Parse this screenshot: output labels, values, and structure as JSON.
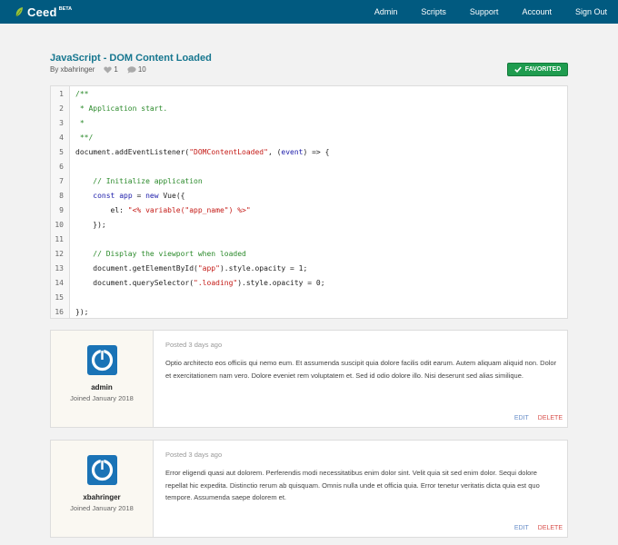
{
  "brand": {
    "name": "Ceed",
    "badge": "BETA",
    "color": "#015a80"
  },
  "nav": [
    "Admin",
    "Scripts",
    "Support",
    "Account",
    "Sign Out"
  ],
  "script": {
    "title": "JavaScript - DOM Content Loaded",
    "author": "By xbahringer",
    "likes": "1",
    "comments": "10",
    "favorite_label": "FAVORITED"
  },
  "code_lines": [
    {
      "n": "1",
      "html": "<span class=\"c\">/**</span>"
    },
    {
      "n": "2",
      "html": "<span class=\"c\"> * Application start.</span>"
    },
    {
      "n": "3",
      "html": "<span class=\"c\"> *</span>"
    },
    {
      "n": "4",
      "html": "<span class=\"c\"> **/</span>"
    },
    {
      "n": "5",
      "html": "document.addEventListener(<span class=\"s\">\"DOMContentLoaded\"</span>, (<span class=\"k\">event</span>) => {"
    },
    {
      "n": "6",
      "html": ""
    },
    {
      "n": "7",
      "html": "    <span class=\"c\">// Initialize application</span>"
    },
    {
      "n": "8",
      "html": "    <span class=\"k\">const</span> <span class=\"k\">app</span> = <span class=\"k\">new</span> Vue({"
    },
    {
      "n": "9",
      "html": "        el: <span class=\"s\">\"&lt;% variable(\"app_name\") %&gt;\"</span>"
    },
    {
      "n": "10",
      "html": "    });"
    },
    {
      "n": "11",
      "html": ""
    },
    {
      "n": "12",
      "html": "    <span class=\"c\">// Display the viewport when loaded</span>"
    },
    {
      "n": "13",
      "html": "    document.getElementById(<span class=\"s\">\"app\"</span>).style.opacity = 1;"
    },
    {
      "n": "14",
      "html": "    document.querySelector(<span class=\"s\">\".loading\"</span>).style.opacity = 0;"
    },
    {
      "n": "15",
      "html": ""
    },
    {
      "n": "16",
      "html": "});"
    }
  ],
  "comments": [
    {
      "user": "admin",
      "joined": "Joined January 2018",
      "posted": "Posted 3 days ago",
      "text": "Optio architecto eos officiis qui nemo eum. Et assumenda suscipit quia dolore facilis odit earum. Autem aliquam aliquid non. Dolor et exercitationem nam vero. Dolore eveniet rem voluptatem et. Sed id odio dolore illo. Nisi deserunt sed alias similique.",
      "edit": "EDIT",
      "delete": "DELETE"
    },
    {
      "user": "xbahringer",
      "joined": "Joined January 2018",
      "posted": "Posted 3 days ago",
      "text": "Error eligendi quasi aut dolorem. Perferendis modi necessitatibus enim dolor sint. Velit quia sit sed enim dolor. Sequi dolore repellat hic expedita. Distinctio rerum ab quisquam. Omnis nulla unde et officia quia. Error tenetur veritatis dicta quia est quo tempore. Assumenda saepe dolorem et.",
      "edit": "EDIT",
      "delete": "DELETE"
    }
  ]
}
